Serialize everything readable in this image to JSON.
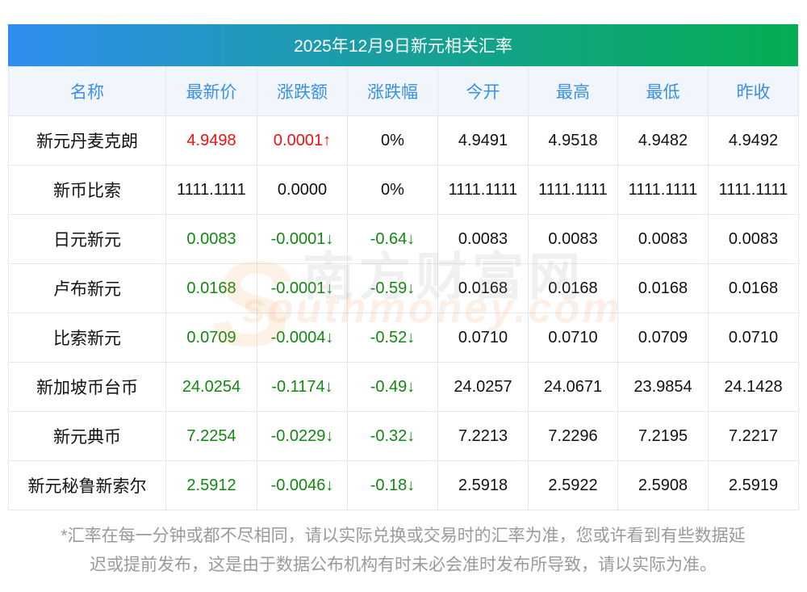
{
  "title": "2025年12月9日新元相关汇率",
  "columns": [
    "名称",
    "最新价",
    "涨跌额",
    "涨跌幅",
    "今开",
    "最高",
    "最低",
    "昨收"
  ],
  "rows": [
    {
      "name": "新元丹麦克朗",
      "latest": "4.9498",
      "change": "0.0001↑",
      "pct": "0%",
      "open": "4.9491",
      "high": "4.9518",
      "low": "4.9482",
      "prev": "4.9492",
      "trend": "up",
      "pct_trend": "none"
    },
    {
      "name": "新币比索",
      "latest": "1111.1111",
      "change": "0.0000",
      "pct": "0%",
      "open": "1111.1111",
      "high": "1111.1111",
      "low": "1111.1111",
      "prev": "1111.1111",
      "trend": "none",
      "pct_trend": "none"
    },
    {
      "name": "日元新元",
      "latest": "0.0083",
      "change": "-0.0001↓",
      "pct": "-0.64↓",
      "open": "0.0083",
      "high": "0.0083",
      "low": "0.0083",
      "prev": "0.0083",
      "trend": "down",
      "pct_trend": "down"
    },
    {
      "name": "卢布新元",
      "latest": "0.0168",
      "change": "-0.0001↓",
      "pct": "-0.59↓",
      "open": "0.0168",
      "high": "0.0168",
      "low": "0.0168",
      "prev": "0.0168",
      "trend": "down",
      "pct_trend": "down"
    },
    {
      "name": "比索新元",
      "latest": "0.0709",
      "change": "-0.0004↓",
      "pct": "-0.52↓",
      "open": "0.0710",
      "high": "0.0710",
      "low": "0.0709",
      "prev": "0.0710",
      "trend": "down",
      "pct_trend": "down"
    },
    {
      "name": "新加坡币台币",
      "latest": "24.0254",
      "change": "-0.1174↓",
      "pct": "-0.49↓",
      "open": "24.0257",
      "high": "24.0671",
      "low": "23.9854",
      "prev": "24.1428",
      "trend": "down",
      "pct_trend": "down"
    },
    {
      "name": "新元典币",
      "latest": "7.2254",
      "change": "-0.0229↓",
      "pct": "-0.32↓",
      "open": "7.2213",
      "high": "7.2296",
      "low": "7.2195",
      "prev": "7.2217",
      "trend": "down",
      "pct_trend": "down"
    },
    {
      "name": "新元秘鲁新索尔",
      "latest": "2.5912",
      "change": "-0.0046↓",
      "pct": "-0.18↓",
      "open": "2.5918",
      "high": "2.5922",
      "low": "2.5908",
      "prev": "2.5919",
      "trend": "down",
      "pct_trend": "down"
    }
  ],
  "note_line1": "*汇率在每一分钟或都不尽相同，请以实际兑换或交易时的汇率为准，您或许看到有些数据延",
  "note_line2": "迟或提前发布，这是由于数据公布机构有时未必会准时发布所导致，请以实际为准。",
  "watermark": {
    "cn": "南方财富网",
    "en": "southmoney.com"
  },
  "colors": {
    "up": "#ee1111",
    "down": "#118811",
    "header_text": "#3c8fe6",
    "gradient_start": "#2f8ef0",
    "gradient_end": "#05ae52"
  }
}
